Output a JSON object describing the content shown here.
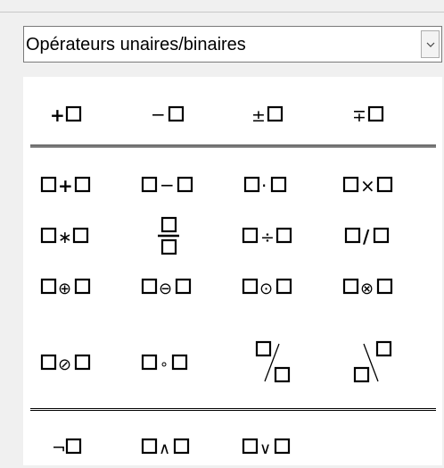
{
  "dropdown": {
    "selected": "Opérateurs unaires/binaires"
  },
  "ops": {
    "plus": "+",
    "minus": "−",
    "plusminus": "±",
    "minusplus": "∓",
    "cdot": "·",
    "times": "×",
    "ast": "∗",
    "div": "÷",
    "slash": "/",
    "oplus": "⊕",
    "ominus": "⊖",
    "odot": "⊙",
    "otimes": "⊗",
    "oslash": "⊘",
    "circ": "∘",
    "neg": "¬",
    "and": "∧",
    "or": "∨"
  },
  "icons": {
    "dropdown": "chevron-down-icon",
    "placeholder": "empty-box"
  }
}
